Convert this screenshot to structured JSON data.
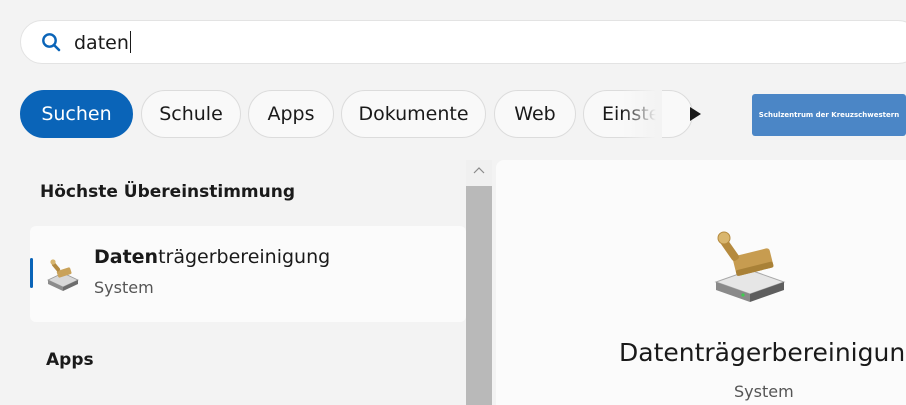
{
  "search": {
    "query": "daten",
    "icon": "search-icon"
  },
  "filters": {
    "tabs": [
      {
        "label": "Suchen",
        "active": true
      },
      {
        "label": "Schule",
        "active": false
      },
      {
        "label": "Apps",
        "active": false
      },
      {
        "label": "Dokumente",
        "active": false
      },
      {
        "label": "Web",
        "active": false
      },
      {
        "label": "Einste",
        "active": false
      }
    ],
    "org_badge": "Schulzentrum der Kreuzschwestern"
  },
  "results": {
    "best_match_heading": "Höchste Übereinstimmung",
    "best_match": {
      "title_match": "Daten",
      "title_rest": "trägerbereinigung",
      "subtitle": "System",
      "icon": "disk-cleanup-icon"
    },
    "apps_heading": "Apps"
  },
  "preview": {
    "title": "Datenträgerbereinigung",
    "subtitle": "System",
    "icon": "disk-cleanup-icon"
  },
  "colors": {
    "accent": "#0a64b8",
    "background": "#f3f3f3",
    "panel": "#fbfbfb"
  }
}
